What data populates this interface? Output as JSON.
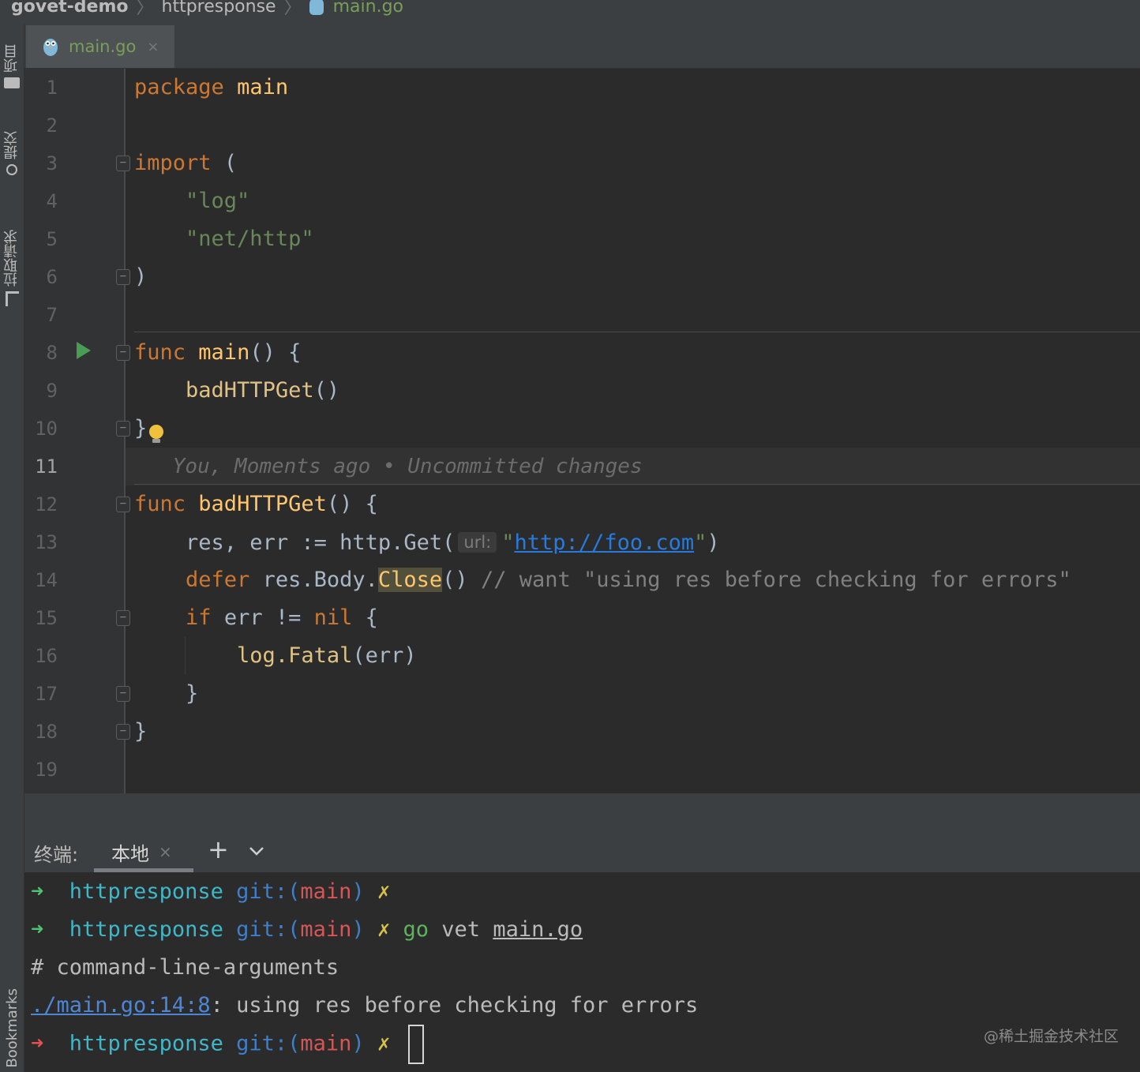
{
  "breadcrumb": {
    "project": "govet-demo",
    "folder": "httpresponse",
    "file": "main.go"
  },
  "left_strip": {
    "project_label": "项目",
    "commit_label": "提交",
    "pull_requests_label": "拉取请求",
    "bookmarks_label": "Bookmarks"
  },
  "tab": {
    "label": "main.go",
    "close": "×"
  },
  "editor": {
    "line_numbers": [
      "1",
      "2",
      "3",
      "4",
      "5",
      "6",
      "7",
      "8",
      "9",
      "10",
      "11",
      "12",
      "13",
      "14",
      "15",
      "16",
      "17",
      "18",
      "19"
    ],
    "current_line": "11",
    "code": {
      "l1_kw": "package",
      "l1_name": "main",
      "l3_kw": "import",
      "l3_paren": "(",
      "l4_str": "\"log\"",
      "l5_str": "\"net/http\"",
      "l6_paren": ")",
      "l8_kw": "func",
      "l8_fn": "main",
      "l8_rest": "() {",
      "l9_call": "badHTTPGet",
      "l9_rest": "()",
      "l10_brace": "}",
      "l11_blame": "You, Moments ago • Uncommitted changes",
      "l12_kw": "func",
      "l12_fn": "badHTTPGet",
      "l12_rest": "() {",
      "l13_lhs": "res, err := http.Get(",
      "l13_hint": "url:",
      "l13_q1": "\"",
      "l13_url": "http://foo.com",
      "l13_q2": "\"",
      "l13_end": ")",
      "l14_kw": "defer",
      "l14_expr": "res.Body.",
      "l14_method": "Close",
      "l14_paren": "()",
      "l14_comment": "// want \"using res before checking for errors\"",
      "l15_kw": "if",
      "l15_mid": "err !=",
      "l15_nil": "nil",
      "l15_brace": "{",
      "l16_pkg": "log.",
      "l16_fn": "Fatal",
      "l16_args": "(err)",
      "l17_brace": "}",
      "l18_brace": "}"
    }
  },
  "terminal": {
    "title": "终端:",
    "tab_label": "本地",
    "tab_close": "×",
    "add_label": "+",
    "lines": {
      "p1_arrow": "➜",
      "p1_dir": "httpresponse",
      "p1_git": "git:(",
      "p1_branch": "main",
      "p1_git_end": ")",
      "p1_x": "✗",
      "p2_arrow": "➜",
      "p2_dir": "httpresponse",
      "p2_git": "git:(",
      "p2_branch": "main",
      "p2_git_end": ")",
      "p2_x": "✗",
      "p2_go": "go",
      "p2_vet": "vet",
      "p2_file": "main.go",
      "out1": "# command-line-arguments",
      "out2_link": "./main.go:14:8",
      "out2_msg": ": using res before checking for errors",
      "p3_arrow": "➜",
      "p3_dir": "httpresponse",
      "p3_git": "git:(",
      "p3_branch": "main",
      "p3_git_end": ")",
      "p3_x": "✗"
    }
  },
  "watermark": "@稀土掘金技术社区",
  "colors": {
    "keyword": "#cc7832",
    "function": "#ffc66d",
    "string": "#6a8759",
    "comment": "#808080",
    "background": "#2b2b2b"
  }
}
